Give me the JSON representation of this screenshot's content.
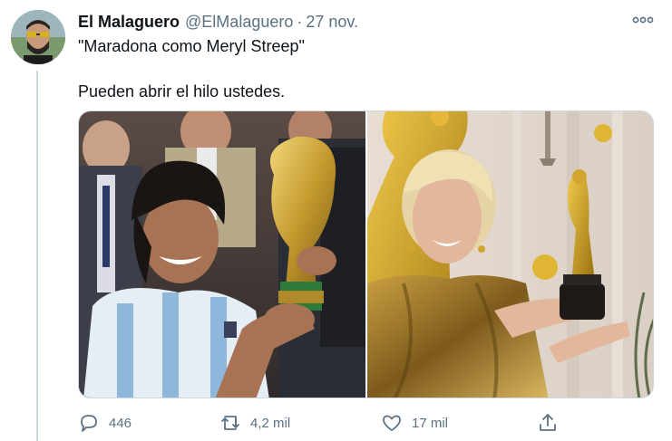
{
  "author": {
    "name": "El Malaguero",
    "handle": "@ElMalaguero",
    "separator": "·",
    "date": "27 nov."
  },
  "tweet": {
    "line1": "\"Maradona como Meryl Streep\"",
    "line2": "Pueden abrir el hilo ustedes."
  },
  "media": {
    "left_photo": "photo-maradona-holding-world-cup-trophy",
    "right_photo": "photo-meryl-streep-holding-oscar"
  },
  "actions": {
    "replies": "446",
    "retweets": "4,2 mil",
    "likes": "17 mil"
  },
  "colors": {
    "text_primary": "#0f1419",
    "text_secondary": "#5b7083",
    "border": "#cfd9de"
  },
  "icons": {
    "more": "more-horizontal-icon",
    "reply": "reply-icon",
    "retweet": "retweet-icon",
    "like": "heart-icon",
    "share": "share-icon"
  }
}
